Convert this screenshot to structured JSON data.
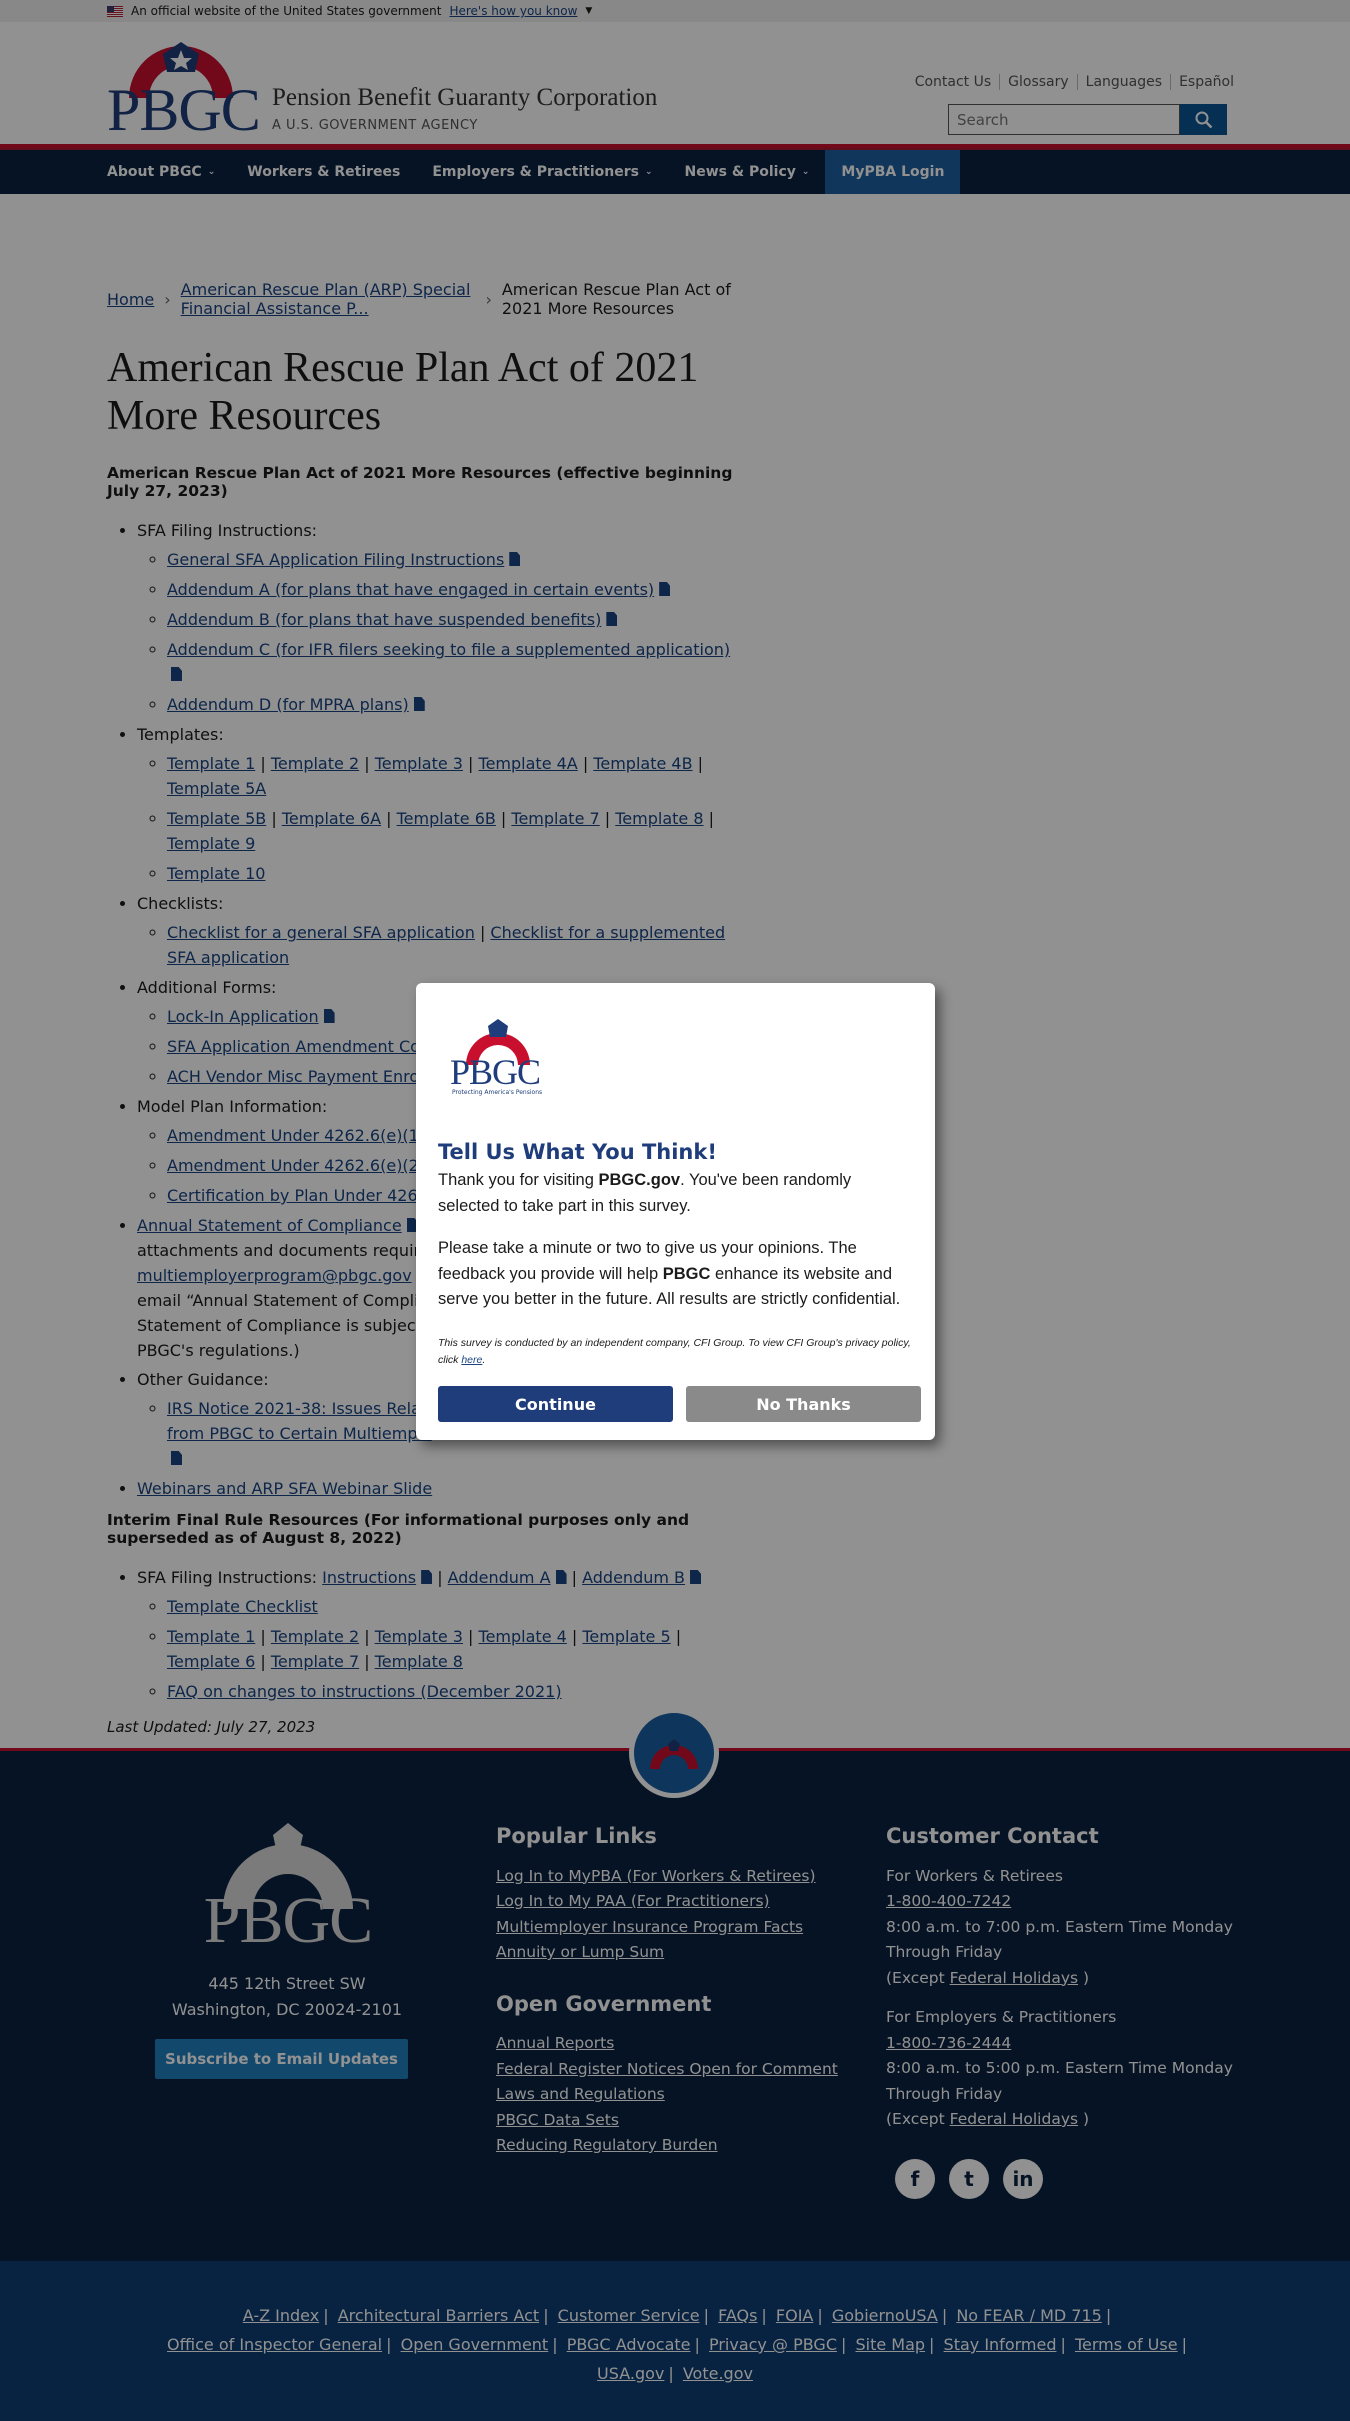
{
  "gov_banner": {
    "text": "An official website of the United States government",
    "link": "Here's how you know"
  },
  "header": {
    "logo_text": "PBGC",
    "org_name": "Pension Benefit Guaranty Corporation",
    "org_sub": "A U.S. GOVERNMENT AGENCY",
    "utility_links": [
      "Contact Us",
      "Glossary",
      "Languages",
      "Español"
    ],
    "search_placeholder": "Search"
  },
  "nav": {
    "items": [
      "About PBGC",
      "Workers & Retirees",
      "Employers & Practitioners",
      "News & Policy",
      "MyPBA Login"
    ]
  },
  "breadcrumb": [
    "Home",
    "American Rescue Plan (ARP) Special Financial Assistance P...",
    "American Rescue Plan Act of 2021 More Resources"
  ],
  "page": {
    "title": "American Rescue Plan Act of 2021 More Resources",
    "subtitle": "American Rescue Plan Act of 2021 More Resources (effective beginning July 27, 2023)",
    "sfa_label": "SFA Filing Instructions:",
    "sfa_items": [
      "General SFA Application Filing Instructions",
      "Addendum A (for plans that have engaged in certain events)",
      "Addendum B (for plans that have suspended benefits)",
      "Addendum C (for IFR filers seeking to file a supplemented application)",
      "Addendum D (for MPRA plans)"
    ],
    "templates_label": "Templates:",
    "templates_row1": [
      "Template 1",
      "Template 2",
      "Template 3",
      "Template 4A",
      "Template 4B",
      "Template 5A"
    ],
    "templates_row2": [
      "Template 5B",
      "Template 6A",
      "Template 6B",
      "Template 7",
      "Template 8",
      "Template 9"
    ],
    "templates_row3": "Template 10",
    "checklists_label": "Checklists:",
    "checklist_a": "Checklist for a general SFA application",
    "checklist_b": "Checklist for a supplemented SFA application",
    "forms_label": "Additional Forms:",
    "forms_items": [
      "Lock-In Application",
      "SFA Application Amendment Cover Letter",
      "ACH Vendor Misc Payment Enroll"
    ],
    "model_label": "Model Plan Information:",
    "model_items": [
      "Amendment Under 4262.6(e)(1) R",
      "Amendment Under 4262.6(e)(2) F",
      "Certification by Plan Under 4262."
    ],
    "annual_link": "Annual Statement of Compliance",
    "annual_text1": "(",
    "annual_text2": "attachments and documents required",
    "annual_email": "multiemployerprogram@pbgc.gov",
    "annual_text3": ",",
    "annual_text4": "email “Annual Statement of Complian",
    "annual_text5": "Statement of Compliance is subject t",
    "annual_text6": "PBGC's regulations.)",
    "other_label": "Other Guidance:",
    "other_item_a": "IRS Notice 2021-38: Issues Relat",
    "other_item_b": "from PBGC to Certain Multiemplo",
    "webinars": "Webinars and ARP SFA Webinar Slide",
    "ifr_heading": "Interim Final Rule Resources (For informational purposes only and superseded as of August 8, 2022)",
    "ifr_sfa_label": "SFA Filing Instructions:",
    "ifr_sfa_links": [
      "Instructions",
      "Addendum A",
      "Addendum B"
    ],
    "ifr_checklist": "Template Checklist",
    "ifr_templates_row1": [
      "Template 1",
      "Template 2",
      "Template 3",
      "Template 4",
      "Template 5"
    ],
    "ifr_templates_row2": [
      "Template 6",
      "Template 7",
      "Template 8"
    ],
    "ifr_faq": "FAQ on changes to instructions (December 2021)",
    "last_updated": "Last Updated: July 27, 2023"
  },
  "modal": {
    "logo_text": "PBGC",
    "logo_tagline": "Protecting America's Pensions",
    "title": "Tell Us What You Think!",
    "p1_a": "Thank you for visiting ",
    "p1_b": "PBGC.gov",
    "p1_c": ". You've been randomly selected to take part in this survey.",
    "p2_a": "Please take a minute or two to give us your opinions. The feedback you provide will help ",
    "p2_b": "PBGC",
    "p2_c": " enhance its website and serve you better in the future. All results are strictly confidential.",
    "fine_a": "This survey is conducted by an independent company, CFI Group. To view CFI Group's privacy policy, click ",
    "fine_link": "here",
    "fine_b": ".",
    "continue": "Continue",
    "no_thanks": "No Thanks"
  },
  "footer": {
    "logo_text": "PBGC",
    "address1": "445 12th Street SW",
    "address2": "Washington, DC 20024-2101",
    "subscribe": "Subscribe to Email Updates",
    "popular_title": "Popular Links",
    "popular": [
      "Log In to MyPBA (For Workers & Retirees)",
      "Log In to My PAA (For Practitioners)",
      "Multiemployer Insurance Program Facts",
      "Annuity or Lump Sum"
    ],
    "open_title": "Open Government",
    "open": [
      "Annual Reports",
      "Federal Register Notices Open for Comment",
      "Laws and Regulations",
      "PBGC Data Sets",
      "Reducing Regulatory Burden"
    ],
    "contact_title": "Customer Contact",
    "workers_label": "For Workers & Retirees",
    "workers_phone": "1-800-400-7242",
    "workers_hours": "8:00 a.m. to 7:00 p.m. Eastern Time Monday Through Friday",
    "employers_label": "For Employers & Practitioners",
    "employers_phone": "1-800-736-2444",
    "employers_hours": "8:00 a.m. to 5:00 p.m. Eastern Time Monday Through Friday",
    "except_a": "(Except ",
    "except_link": "Federal Holidays",
    "except_b": " )",
    "social": [
      "f",
      "t",
      "in"
    ],
    "bottom_row1": [
      "A-Z Index",
      "Architectural Barriers Act",
      "Customer Service",
      "FAQs",
      "FOIA",
      "GobiernoUSA",
      "No FEAR / MD 715"
    ],
    "bottom_row2": [
      "Office of Inspector General",
      "Open Government",
      "PBGC Advocate",
      "Privacy @ PBGC",
      "Site Map",
      "Stay Informed",
      "Terms of Use"
    ],
    "bottom_row3": [
      "USA.gov",
      "Vote.gov"
    ]
  }
}
